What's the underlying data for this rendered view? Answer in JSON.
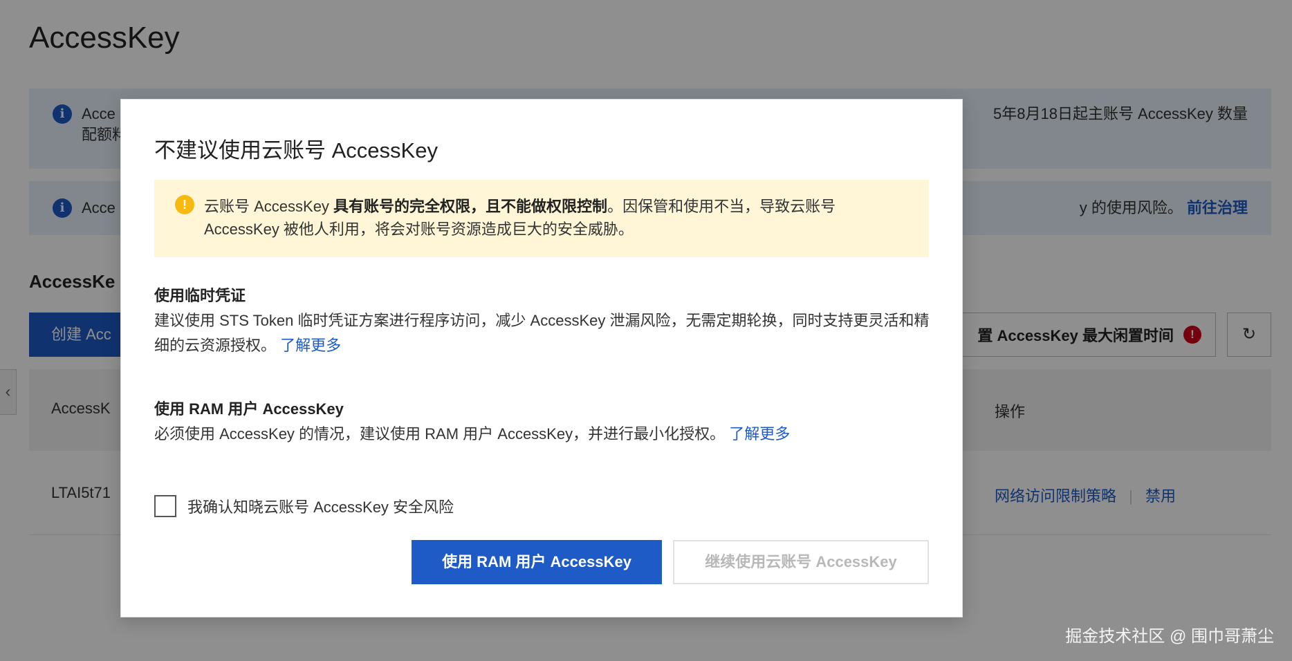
{
  "page": {
    "title": "AccessKey",
    "alert1": {
      "left_text": "Acce",
      "left_text_line2": "配额料",
      "right_text": "5年8月18日起主账号 AccessKey 数量"
    },
    "alert2": {
      "left_text": "Acce",
      "right_text": "y 的使用风险。",
      "link": "前往治理"
    },
    "section_title": "AccessKe",
    "create_button": "创建 Acc",
    "idle_button": "置 AccessKey 最大闲置时间",
    "idle_alert_symbol": "!",
    "refresh_icon": "↻",
    "collapse_icon": "‹",
    "table": {
      "header_left": "AccessK",
      "header_right": "操作",
      "row_left": "LTAI5t71",
      "row_link_1": "网络访问限制策略",
      "row_sep": "|",
      "row_link_2": "禁用"
    }
  },
  "modal": {
    "title": "不建议使用云账号 AccessKey",
    "warning": {
      "icon": "!",
      "text_pre": "云账号 AccessKey ",
      "text_bold": "具有账号的完全权限，且不能做权限控制",
      "text_post": "。因保管和使用不当，导致云账号 AccessKey 被他人利用，将会对账号资源造成巨大的安全威胁。"
    },
    "section1": {
      "title": "使用临时凭证",
      "body": "建议使用 STS Token 临时凭证方案进行程序访问，减少 AccessKey 泄漏风险，无需定期轮换，同时支持更灵活和精细的云资源授权。",
      "link": "了解更多"
    },
    "section2": {
      "title": "使用 RAM 用户 AccessKey",
      "body": "必须使用 AccessKey 的情况，建议使用 RAM 用户 AccessKey，并进行最小化授权。",
      "link": "了解更多"
    },
    "confirm_label": "我确认知晓云账号 AccessKey 安全风险",
    "primary_button": "使用 RAM 用户 AccessKey",
    "secondary_button": "继续使用云账号 AccessKey"
  },
  "watermark": "掘金技术社区 @ 围巾哥萧尘",
  "colors": {
    "primary": "#1e5bc6",
    "warning_bg": "#fef6d6",
    "warning_icon": "#f5b90f",
    "danger": "#d0021b",
    "overlay": "rgba(0,0,0,0.44)"
  }
}
